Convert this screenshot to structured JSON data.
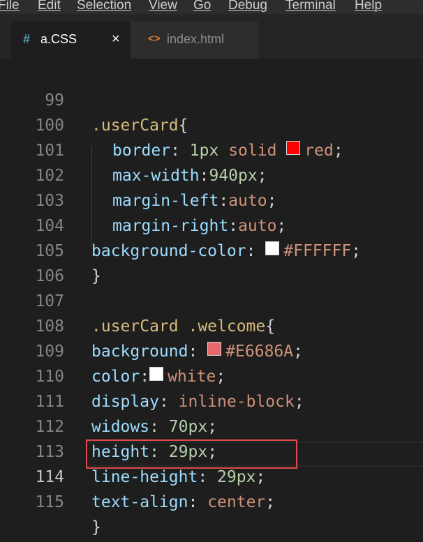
{
  "menu": [
    "File",
    "Edit",
    "Selection",
    "View",
    "Go",
    "Debug",
    "Terminal",
    "Help"
  ],
  "tabs": [
    {
      "icon": "#",
      "label": "a.CSS",
      "close": "×",
      "active": true
    },
    {
      "icon": "<>",
      "label": "index.html",
      "active": false
    }
  ],
  "colors": {
    "red": "#FF0000",
    "white": "#FFFFFF",
    "welcome_bg": "#E6686A",
    "highlight_box": "#E04A4A"
  },
  "lines": [
    {
      "n": "99",
      "parts": [
        ".userCard",
        "{"
      ]
    },
    {
      "n": "100",
      "parts": [
        "border",
        ":",
        " 1px",
        " solid ",
        "red",
        ";"
      ]
    },
    {
      "n": "101",
      "parts": [
        "max-width",
        ":",
        "940px",
        ";"
      ]
    },
    {
      "n": "102",
      "parts": [
        "margin-left",
        ":",
        "auto",
        ";"
      ]
    },
    {
      "n": "103",
      "parts": [
        "margin-right",
        ":",
        "auto",
        ";"
      ]
    },
    {
      "n": "104",
      "parts": [
        "background-color",
        ": ",
        "#FFFFFF",
        ";"
      ]
    },
    {
      "n": "105",
      "parts": [
        "}"
      ]
    },
    {
      "n": "106",
      "parts": []
    },
    {
      "n": "107",
      "parts": [
        ".userCard .welcome",
        "{"
      ]
    },
    {
      "n": "108",
      "parts": [
        "background",
        ": ",
        "#E6686A",
        ";"
      ]
    },
    {
      "n": "109",
      "parts": [
        "color",
        ":",
        "white",
        ";"
      ]
    },
    {
      "n": "110",
      "parts": [
        "display",
        ": ",
        "inline-block",
        ";"
      ]
    },
    {
      "n": "111",
      "parts": [
        "widows",
        ": ",
        "70px",
        ";"
      ]
    },
    {
      "n": "112",
      "parts": [
        "height",
        ": ",
        "29px",
        ";"
      ]
    },
    {
      "n": "113",
      "parts": [
        "line-height",
        ": ",
        "29px",
        ";"
      ]
    },
    {
      "n": "114",
      "parts": [
        "text-align",
        ": ",
        "center",
        ";"
      ]
    },
    {
      "n": "115",
      "parts": [
        "}"
      ]
    }
  ]
}
